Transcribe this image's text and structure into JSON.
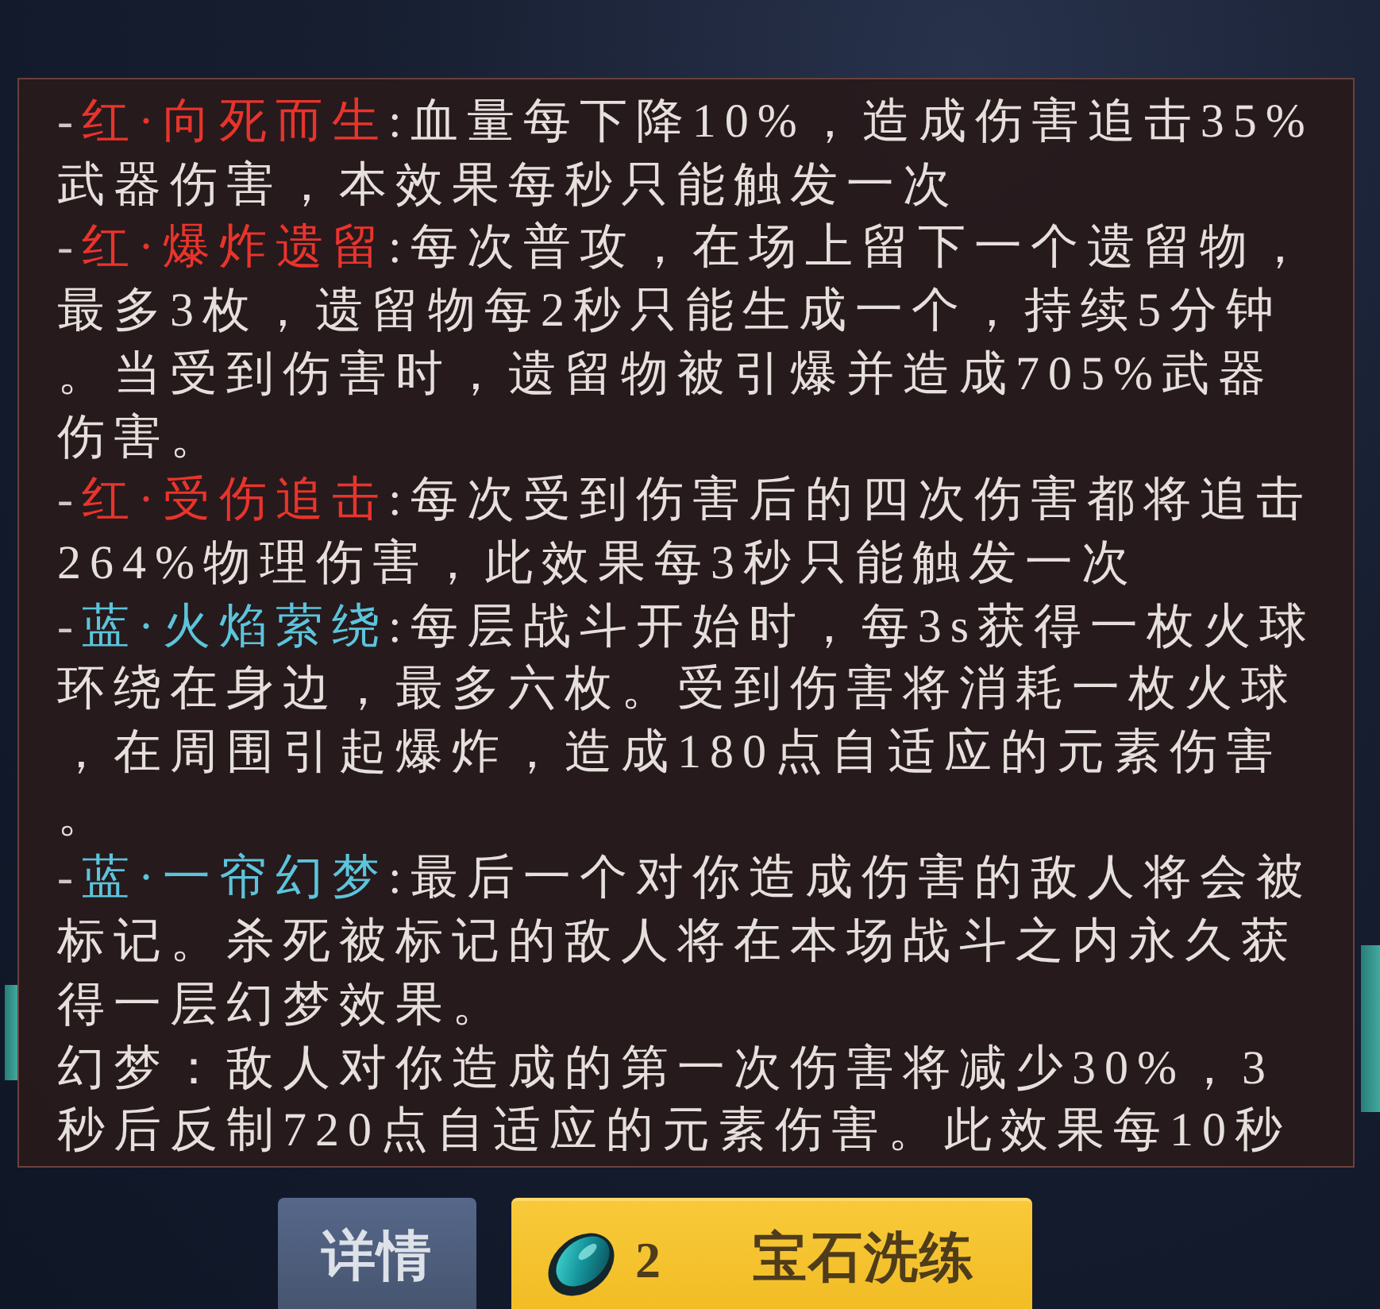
{
  "effects": [
    {
      "kind": "effect",
      "bullet": "-",
      "name": "红·向死而生",
      "color": "#e8342c",
      "text": ":血量每下降10%，造成伤害追击35%武器伤害，本效果每秒只能触发一次"
    },
    {
      "kind": "effect",
      "bullet": "-",
      "name": "红·爆炸遗留",
      "color": "#e8342c",
      "text": ":每次普攻，在场上留下一个遗留物，最多3枚，遗留物每2秒只能生成一个，持续5分钟。当受到伤害时，遗留物被引爆并造成705%武器伤害。"
    },
    {
      "kind": "effect",
      "bullet": "-",
      "name": "红·受伤追击",
      "color": "#e8342c",
      "text": ":每次受到伤害后的四次伤害都将追击264%物理伤害，此效果每3秒只能触发一次"
    },
    {
      "kind": "effect",
      "bullet": "-",
      "name": "蓝·火焰萦绕",
      "color": "#5cc4dc",
      "text": ":每层战斗开始时，每3s获得一枚火球环绕在身边，最多六枚。受到伤害将消耗一枚火球，在周围引起爆炸，造成180点自适应的元素伤害。"
    },
    {
      "kind": "effect",
      "bullet": "-",
      "name": "蓝·一帘幻梦",
      "color": "#5cc4dc",
      "text": ":最后一个对你造成伤害的敌人将会被标记。杀死被标记的敌人将在本场战斗之内永久获得一层幻梦效果。"
    },
    {
      "kind": "note",
      "text": "幻梦：敌人对你造成的第一次伤害将减少30%，3秒后反制720点自适应的元素伤害。此效果每10秒"
    }
  ],
  "buttons": [
    {
      "kind": "secondary",
      "label": "详情"
    },
    {
      "kind": "primary",
      "count": "2",
      "label": "宝石洗练"
    }
  ]
}
